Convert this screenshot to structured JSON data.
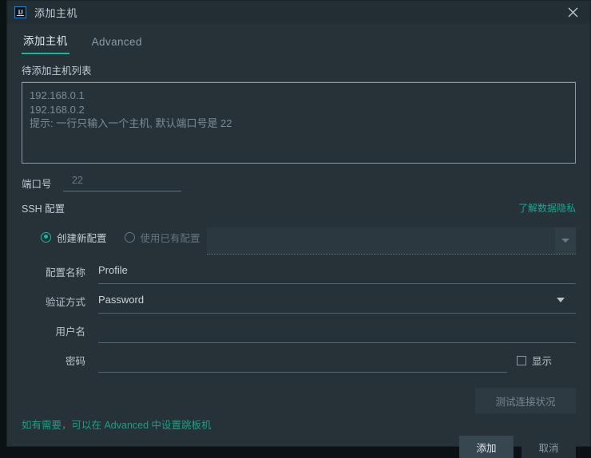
{
  "window": {
    "title": "添加主机",
    "app_icon": "intellij-idea-icon",
    "close_icon": "close-icon"
  },
  "tabs": [
    {
      "label": "添加主机",
      "active": true
    },
    {
      "label": "Advanced",
      "active": false
    }
  ],
  "host_list": {
    "label": "待添加主机列表",
    "placeholder_lines": [
      "192.168.0.1",
      "192.168.0.2",
      "提示: 一行只输入一个主机, 默认端口号是 22"
    ],
    "value": ""
  },
  "port": {
    "label": "端口号",
    "placeholder": "22",
    "value": ""
  },
  "ssh": {
    "section_title": "SSH 配置",
    "privacy_link": "了解数据隐私",
    "mode_options": [
      {
        "label": "创建新配置",
        "selected": true,
        "disabled": false
      },
      {
        "label": "使用已有配置",
        "selected": false,
        "disabled": true
      }
    ],
    "existing_profile_combo": {
      "value": "",
      "disabled": true,
      "arrow_icon": "chevron-down-icon"
    }
  },
  "form": {
    "profile_name": {
      "label": "配置名称",
      "value": "Profile"
    },
    "auth_method": {
      "label": "验证方式",
      "value": "Password",
      "options": [
        "Password"
      ],
      "arrow_icon": "chevron-down-icon"
    },
    "username": {
      "label": "用户名",
      "value": ""
    },
    "password": {
      "label": "密码",
      "value": ""
    },
    "show_password": {
      "label": "显示",
      "checked": false
    }
  },
  "actions": {
    "test_connection": "测试连接状况",
    "advanced_hint": "如有需要，可以在 Advanced 中设置跳板机",
    "confirm": "添加",
    "cancel": "取消"
  },
  "colors": {
    "accent_teal": "#17b8a0",
    "link_teal": "#17a793",
    "dialog_bg": "#263238",
    "titlebar_bg": "#222d34"
  }
}
